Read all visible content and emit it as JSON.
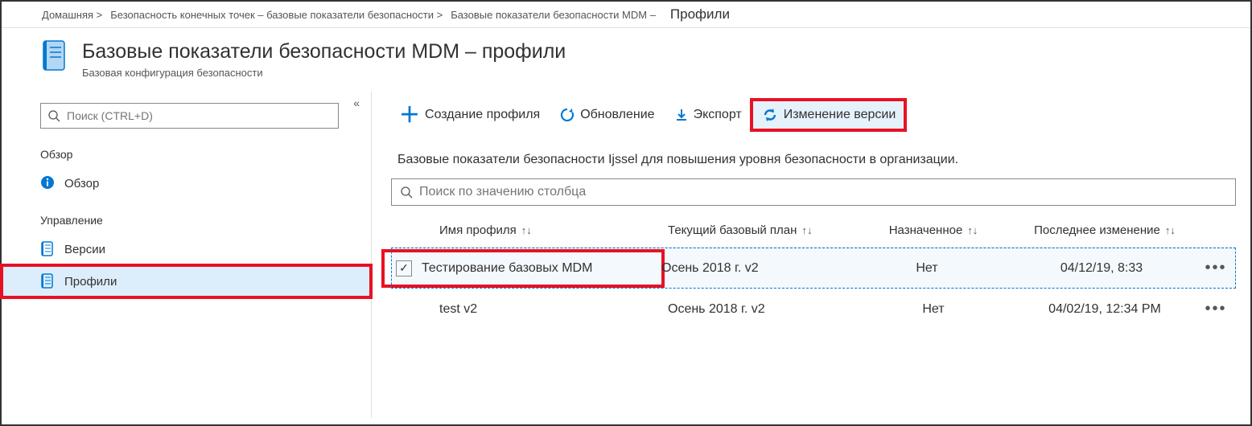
{
  "breadcrumb": {
    "home": "Домашняя >",
    "endpoint": "Безопасность конечных точек – базовые показатели безопасности >",
    "mdm": "Базовые показатели безопасности MDM –",
    "current": "Профили"
  },
  "header": {
    "title": "Базовые показатели безопасности MDM – профили",
    "subtitle": "Базовая конфигурация безопасности"
  },
  "sidebar": {
    "search_placeholder": "Поиск (CTRL+D)",
    "section_overview": "Обзор",
    "item_overview": "Обзор",
    "section_manage": "Управление",
    "item_versions": "Версии",
    "item_profiles": "Профили"
  },
  "toolbar": {
    "create": "Создание профиля",
    "refresh": "Обновление",
    "export": "Экспорт",
    "change_version": "Изменение версии"
  },
  "main": {
    "description": "Базовые показатели безопасности Ijssel для повышения уровня безопасности в организации.",
    "col_search_placeholder": "Поиск по значению столбца"
  },
  "columns": {
    "name": "Имя профиля",
    "baseline": "Текущий базовый план",
    "assigned": "Назначенное",
    "modified": "Последнее изменение",
    "sort": "↑↓"
  },
  "rows": [
    {
      "name": "Тестирование базовых MDM",
      "baseline": "Осень 2018 г. v2",
      "assigned": "Нет",
      "modified": "04/12/19, 8:33",
      "selected": true
    },
    {
      "name": "test v2",
      "baseline": "Осень 2018 г. v2",
      "assigned": "Нет",
      "modified": "04/02/19, 12:34 PM",
      "selected": false
    }
  ]
}
